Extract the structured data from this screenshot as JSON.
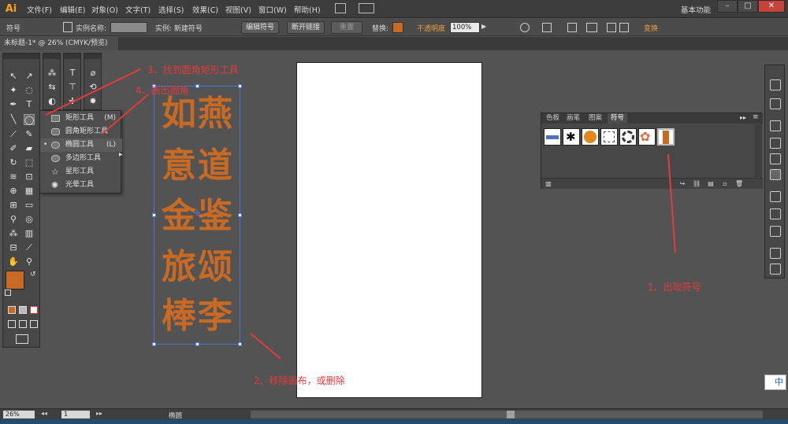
{
  "app": {
    "logo": "Ai"
  },
  "menubar": {
    "items": [
      "文件(F)",
      "编辑(E)",
      "对象(O)",
      "文字(T)",
      "选择(S)",
      "效果(C)",
      "视图(V)",
      "窗口(W)",
      "帮助(H)"
    ],
    "workspace": "基本功能",
    "window_controls": {
      "minimize": "–",
      "restore": "□",
      "close": "✕"
    }
  },
  "controlbar": {
    "selection_label": "符号",
    "instance_name_label": "实例名称:",
    "instance_label": "实例: 新建符号",
    "edit_symbol": "编辑符号",
    "break_link": "断开链接",
    "reset": "重置",
    "replace_label": "替换:",
    "opacity_label": "不透明度",
    "opacity_value": "100%",
    "transform_label": "变换"
  },
  "document": {
    "tab_title": "未标题-1* @ 26% (CMYK/预览)"
  },
  "flyout": {
    "items": [
      {
        "label": "矩形工具",
        "shortcut": "(M)"
      },
      {
        "label": "圆角矩形工具",
        "shortcut": ""
      },
      {
        "label": "椭圆工具",
        "shortcut": "(L)"
      },
      {
        "label": "多边形工具",
        "shortcut": ""
      },
      {
        "label": "星形工具",
        "shortcut": ""
      },
      {
        "label": "光晕工具",
        "shortcut": ""
      }
    ]
  },
  "artwork": {
    "characters": [
      "如燕",
      "意道",
      "金鉴",
      "旅颂",
      "棒李"
    ],
    "color": "#c96a24"
  },
  "symbols_panel": {
    "tabs": [
      "色板",
      "画笔",
      "图案",
      "符号"
    ],
    "active_tab": "符号"
  },
  "annotations": {
    "a1": "1、出现符号",
    "a2": "2、移除画布，或删除",
    "a3": "3、找到圆角矩形工具",
    "a4": "4、画出圆角"
  },
  "statusbar": {
    "zoom": "26%",
    "page": "1",
    "tool": "椭圆"
  },
  "ime": "中",
  "colors": {
    "fill": "#c96a24",
    "accent_orange": "#f7a11a",
    "annotation_red": "#e23b3b"
  }
}
